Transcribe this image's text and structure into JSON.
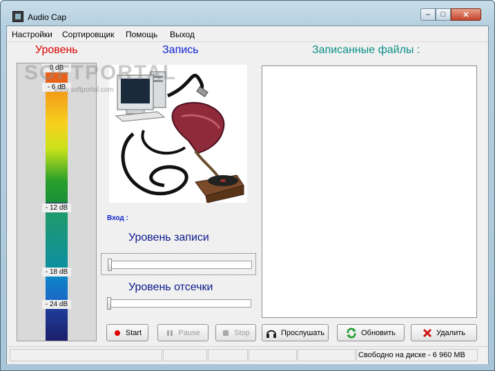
{
  "window": {
    "title": "Audio Cap",
    "min_symbol": "–",
    "max_symbol": "□",
    "close_symbol": "✕"
  },
  "menu": {
    "items": [
      "Настройки",
      "Сортировщик",
      "Помощь",
      "Выход"
    ]
  },
  "headers": {
    "level": "Уровень",
    "record": "Запись",
    "files": "Записанные файлы :"
  },
  "meter": {
    "labels": [
      "0 dB",
      "- 6 dB",
      "- 12 dB",
      "- 18 dB",
      "- 24 dB"
    ]
  },
  "controls": {
    "input_label": "Вход :",
    "record_level_label": "Уровень записи",
    "cutoff_level_label": "Уровень отсечки",
    "record_level_value": 0,
    "cutoff_level_value": 0
  },
  "buttons": {
    "start": "Start",
    "pause": "Pause",
    "stop": "Stop",
    "listen": "Прослушать",
    "refresh": "Обновить",
    "delete": "Удалить"
  },
  "status": {
    "disk_label": "Свободно на диске -",
    "disk_value": "6 960 MB"
  },
  "watermark": {
    "main": "SOFTPORTAL",
    "sub": "www.softportal.com"
  },
  "colors": {
    "level_header": "#e00000",
    "record_header": "#0b1fd0",
    "files_header": "#0c8f86",
    "start_dot": "#e00000",
    "delete_x": "#d01010"
  }
}
